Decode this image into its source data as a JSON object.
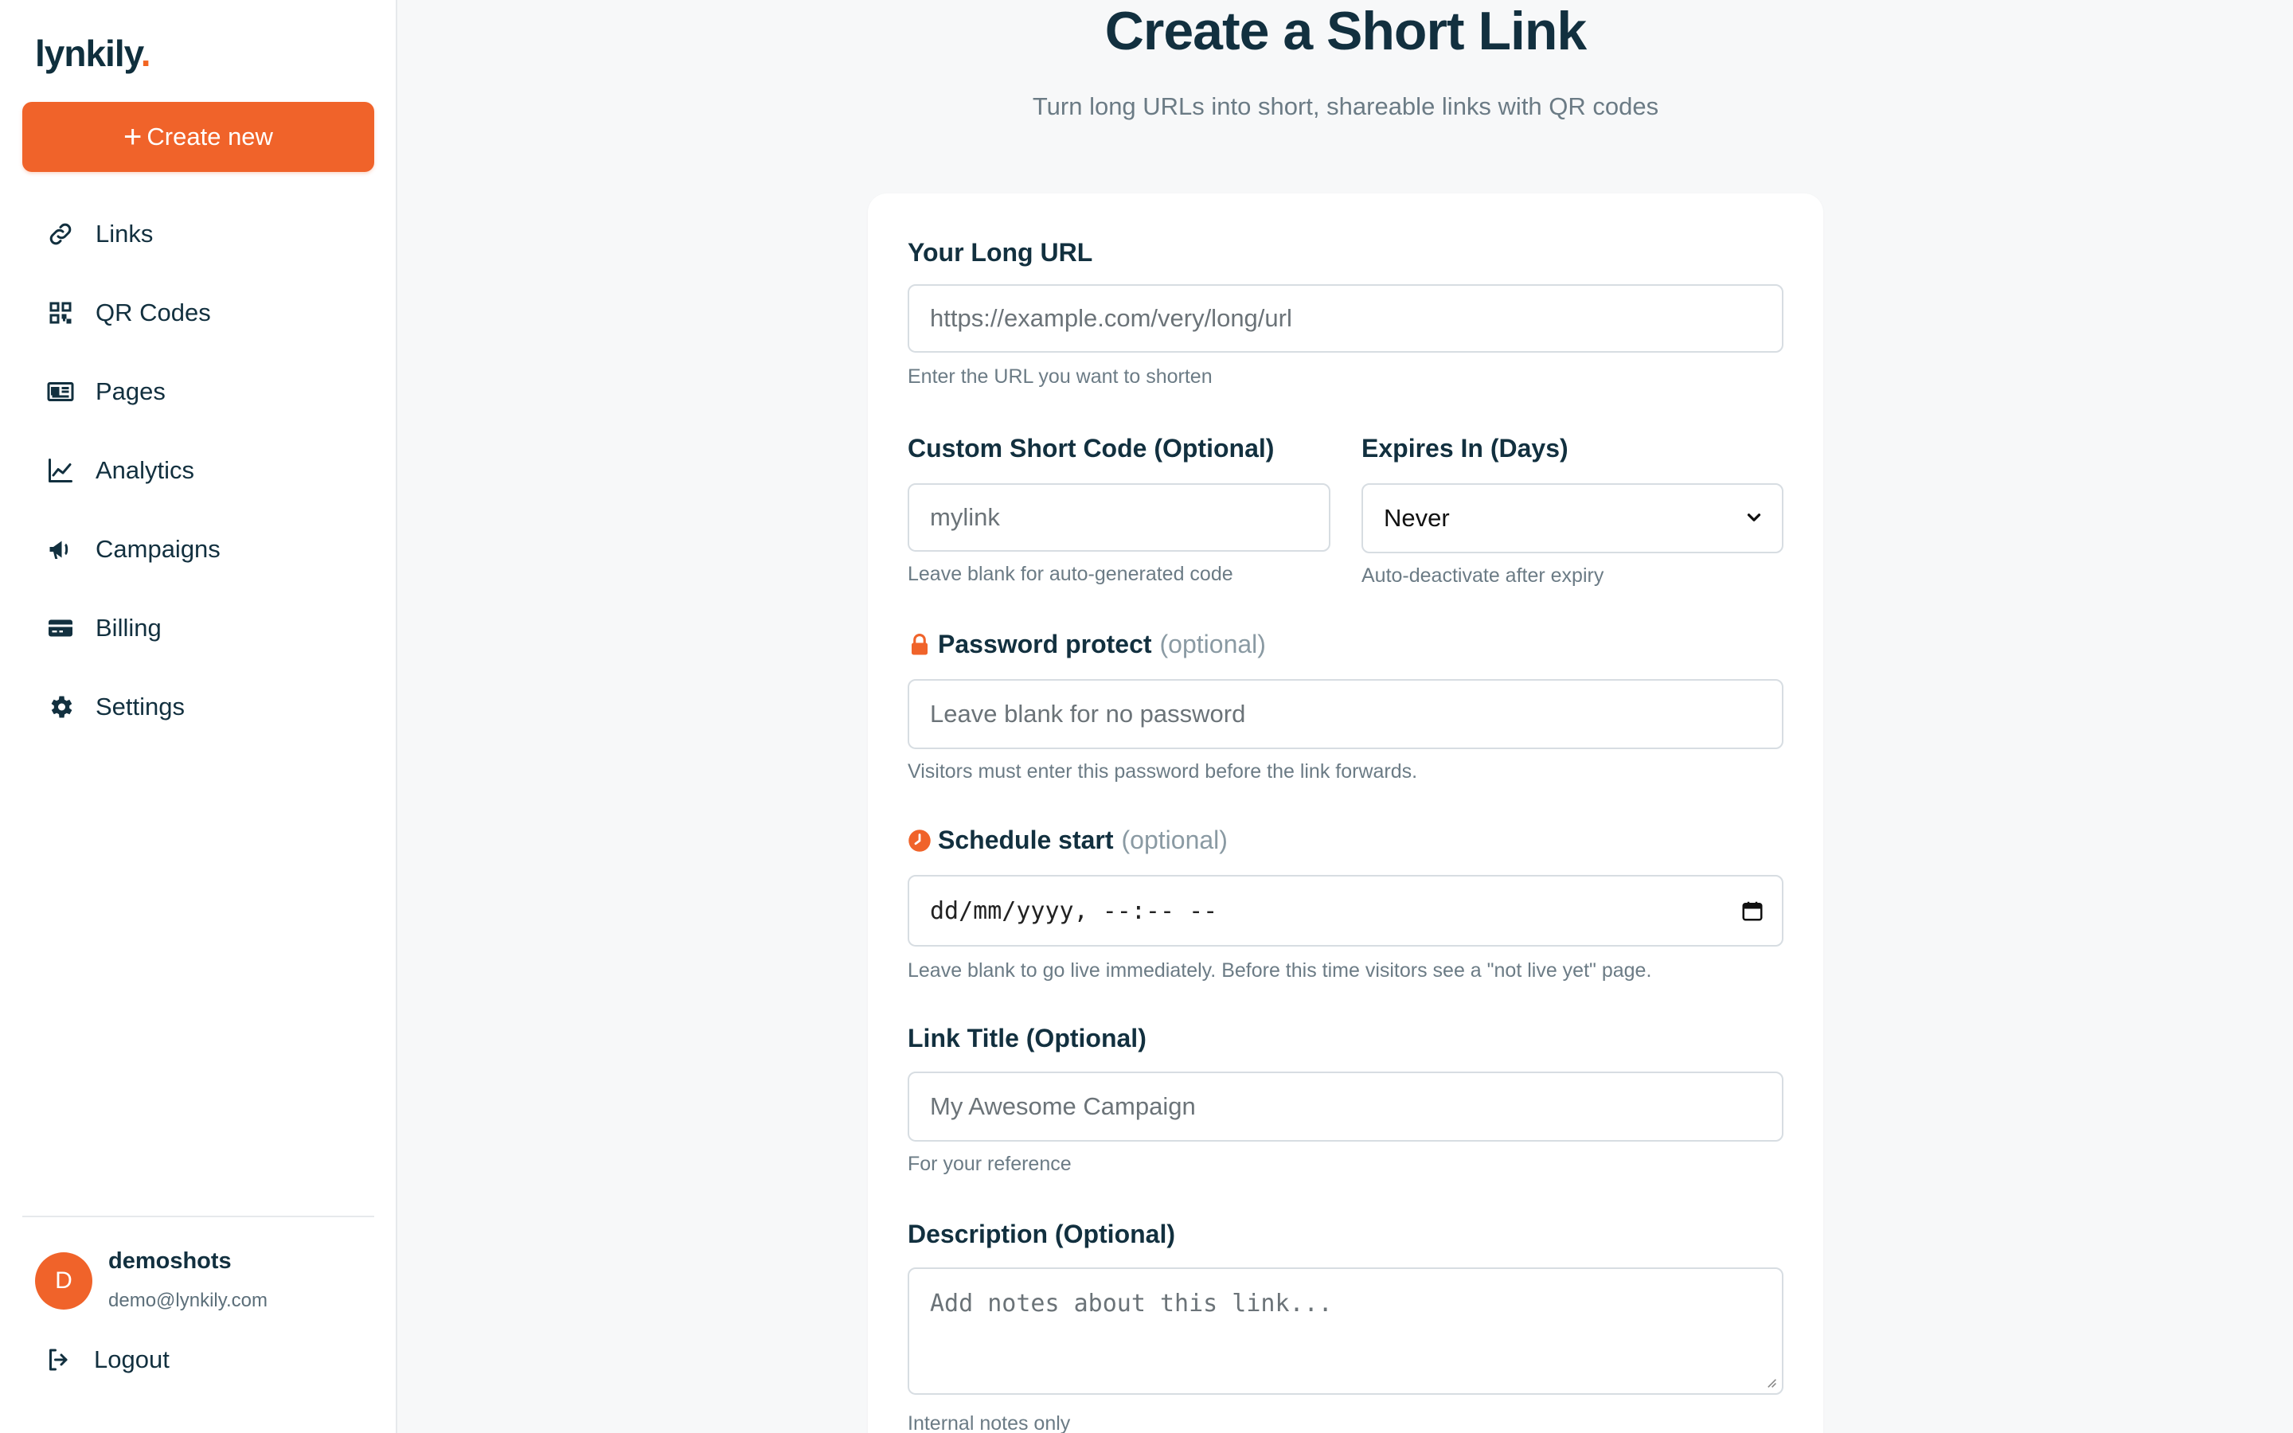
{
  "brand": {
    "name": "lynkily",
    "dot": ".",
    "accent": "#f0632a"
  },
  "sidebar": {
    "create_label": "Create new",
    "items": [
      {
        "label": "Links",
        "icon": "link-icon"
      },
      {
        "label": "QR Codes",
        "icon": "qr-code-icon"
      },
      {
        "label": "Pages",
        "icon": "pages-icon"
      },
      {
        "label": "Analytics",
        "icon": "analytics-icon"
      },
      {
        "label": "Campaigns",
        "icon": "megaphone-icon"
      },
      {
        "label": "Billing",
        "icon": "credit-card-icon"
      },
      {
        "label": "Settings",
        "icon": "gear-icon"
      }
    ],
    "user": {
      "initial": "D",
      "name": "demoshots",
      "email": "demo@lynkily.com"
    },
    "logout_label": "Logout"
  },
  "main": {
    "title": "Create a Short Link",
    "subtitle": "Turn long URLs into short, shareable links with QR codes",
    "form": {
      "long_url": {
        "label": "Your Long URL",
        "placeholder": "https://example.com/very/long/url",
        "help": "Enter the URL you want to shorten"
      },
      "short_code": {
        "label": "Custom Short Code (Optional)",
        "placeholder": "mylink",
        "help": "Leave blank for auto-generated code"
      },
      "expires": {
        "label": "Expires In (Days)",
        "value": "Never",
        "help": "Auto-deactivate after expiry"
      },
      "password": {
        "label": "Password protect",
        "optional": "(optional)",
        "placeholder": "Leave blank for no password",
        "help": "Visitors must enter this password before the link forwards."
      },
      "schedule": {
        "label": "Schedule start",
        "optional": "(optional)",
        "value": "dd/mm/yyyy, --:-- --",
        "help": "Leave blank to go live immediately. Before this time visitors see a \"not live yet\" page."
      },
      "link_title": {
        "label": "Link Title (Optional)",
        "placeholder": "My Awesome Campaign",
        "help": "For your reference"
      },
      "description": {
        "label": "Description (Optional)",
        "placeholder": "Add notes about this link...",
        "help": "Internal notes only"
      }
    }
  }
}
